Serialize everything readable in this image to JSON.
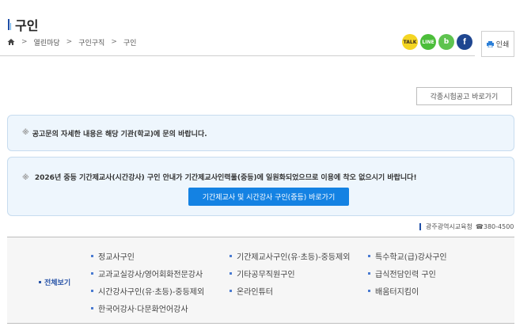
{
  "page": {
    "title": "구인"
  },
  "breadcrumb": {
    "items": [
      "열린마당",
      "구인구직",
      "구인"
    ],
    "separator": ">"
  },
  "share": {
    "kakao_label": "TALK",
    "line_label": "LINE",
    "band_label": "b",
    "facebook_label": "f"
  },
  "print": {
    "label": "인쇄"
  },
  "exam_button": {
    "label": "각종시험공고 바로가기"
  },
  "notices": {
    "mark": "※",
    "first": "공고문의 자세한 내용은 해당 기관(학교)에 문의 바랍니다.",
    "second": "2026년 중등 기간제교사(시간강사) 구인 안내가 기간제교사인력풀(중등)에 일원화되었으므로 이용에 착오 없으시기 바랍니다!",
    "button": "기간제교사 및 시간강사 구인(중등) 바로가기"
  },
  "contact": {
    "org": "광주광역시교육청",
    "phone_icon": "☎",
    "phone": "380-4500"
  },
  "all_view": {
    "label": "전체보기",
    "links": [
      "정교사구인",
      "기간제교사구인(유·초등)-중등제외",
      "특수학교(급)강사구인",
      "교과교실강사/영어회화전문강사",
      "기타공무직원구인",
      "급식전담인력 구인",
      "시간강사구인(유·초등)-중등제외",
      "온라인튜터",
      "배움터지킴이",
      "한국어강사·다문화언어강사"
    ]
  },
  "colors": {
    "accent": "#1482e3",
    "notice_bg": "#eef6fd",
    "label_blue": "#2a55a8"
  }
}
